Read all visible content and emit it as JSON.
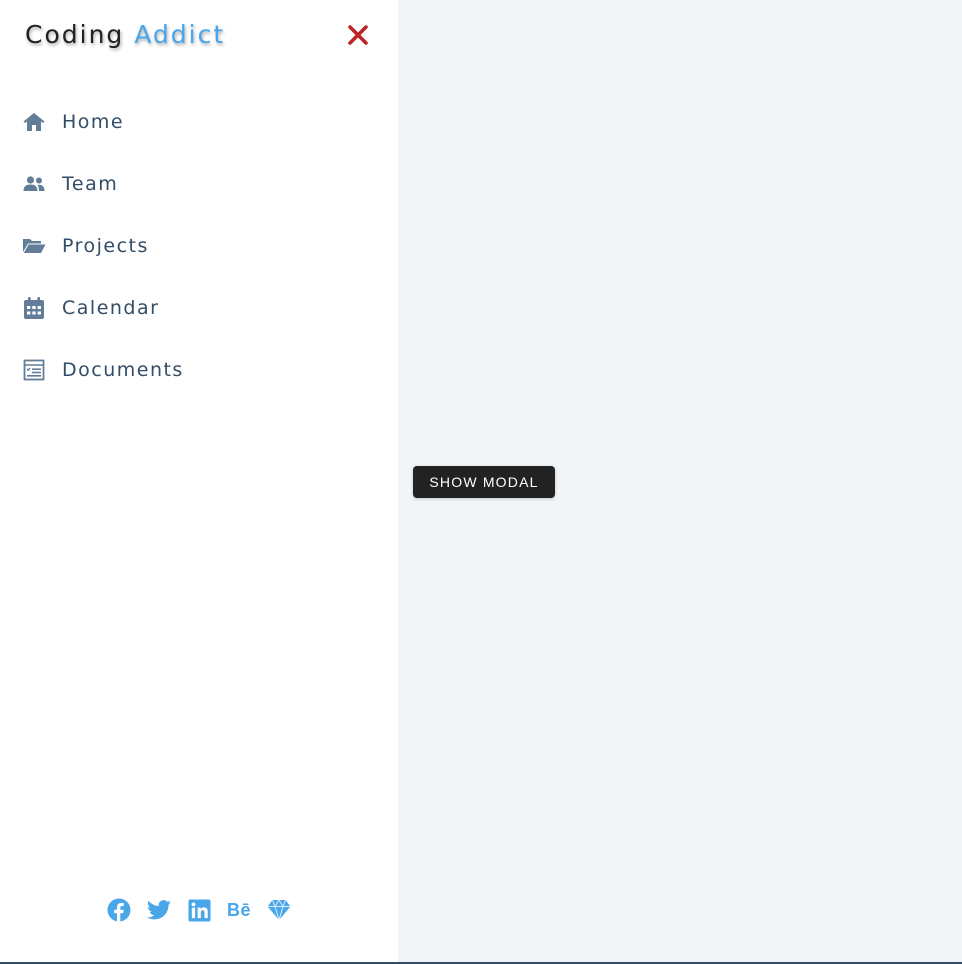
{
  "logo": {
    "part1": "Coding",
    "part2": "Addict"
  },
  "close_icon": "close-icon",
  "nav": [
    {
      "label": "Home",
      "icon": "home-icon"
    },
    {
      "label": "Team",
      "icon": "users-icon"
    },
    {
      "label": "Projects",
      "icon": "folder-open-icon"
    },
    {
      "label": "Calendar",
      "icon": "calendar-icon"
    },
    {
      "label": "Documents",
      "icon": "document-icon"
    }
  ],
  "social": [
    "facebook-icon",
    "twitter-icon",
    "linkedin-icon",
    "behance-icon",
    "sketch-icon"
  ],
  "main": {
    "show_modal_label": "SHOW MODAL"
  },
  "colors": {
    "sidebar_bg": "#ffffff",
    "main_bg": "#f1f5f8",
    "accent": "#49a6e9",
    "nav_text": "#324d67",
    "close_red": "#bb2525",
    "button_bg": "#222222"
  }
}
